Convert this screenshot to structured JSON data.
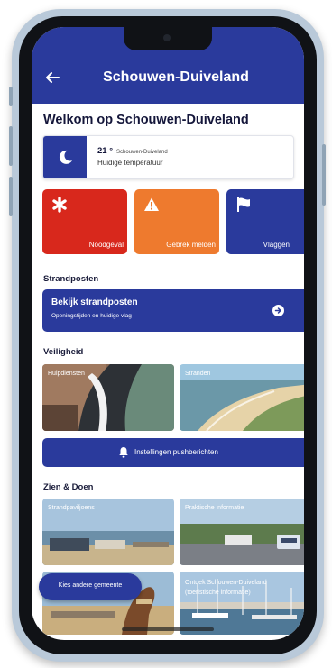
{
  "header": {
    "title": "Schouwen-Duiveland",
    "back_icon": "arrow-left-icon"
  },
  "welcome": "Welkom op Schouwen-Duiveland",
  "weather": {
    "temperature": "21 °",
    "location": "Schouwen-Duiveland",
    "label": "Huidige temperatuur",
    "icon": "moon-icon"
  },
  "actions": [
    {
      "label": "Noodgeval",
      "icon": "asterisk-icon",
      "color": "#d8281c"
    },
    {
      "label": "Gebrek melden",
      "icon": "warning-icon",
      "color": "#ee7a2e"
    },
    {
      "label": "Vlaggen",
      "icon": "flag-icon",
      "color": "#2a3a9c"
    }
  ],
  "strandposten": {
    "section_title": "Strandposten",
    "card_title": "Bekijk strandposten",
    "card_subtitle": "Openingstijden en huidige vlag"
  },
  "veiligheid": {
    "section_title": "Veiligheid",
    "tiles": [
      {
        "label": "Hulpdiensten"
      },
      {
        "label": "Stranden"
      }
    ],
    "push_button": "Instellingen pushberichten"
  },
  "zien_doen": {
    "section_title": "Zien & Doen",
    "tiles": [
      {
        "label": "Strandpaviljoens"
      },
      {
        "label": "Praktische informatie"
      },
      {
        "label": ""
      },
      {
        "label": "Ontdek Schouwen-Duiveland (toeristische informatie)"
      }
    ]
  },
  "fab": {
    "label": "Kies andere gemeente"
  },
  "colors": {
    "primary": "#2a3a9c",
    "danger": "#d8281c",
    "warning": "#ee7a2e"
  }
}
